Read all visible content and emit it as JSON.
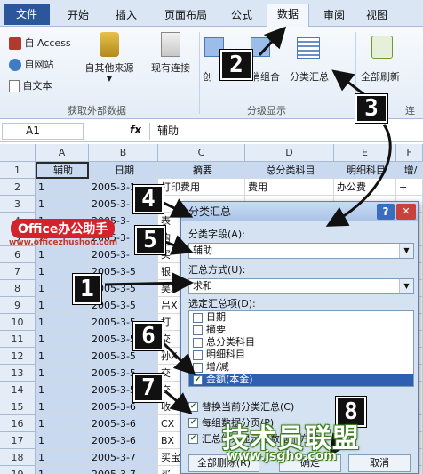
{
  "ribbon": {
    "tabs": [
      "文件",
      "开始",
      "插入",
      "页面布局",
      "公式",
      "数据",
      "审阅",
      "视图"
    ],
    "active_tab": "数据",
    "buttons": {
      "access": "自 Access",
      "web": "自网站",
      "text": "自文本",
      "other_sources": "自其他来源",
      "existing": "现有连接",
      "create_group": "创",
      "ungroup": "消组合",
      "subtotal": "分类汇总",
      "refresh_all": "全部刷新"
    },
    "group_labels": {
      "external": "获取外部数据",
      "outline": "分级显示",
      "connections": "连"
    }
  },
  "formula_bar": {
    "cell_ref": "A1",
    "fx": "fx",
    "value": "辅助"
  },
  "sheet": {
    "columns": [
      "A",
      "B",
      "C",
      "D",
      "E",
      "F"
    ],
    "header_row": [
      "辅助",
      "日期",
      "摘要",
      "总分类科目",
      "明细科目",
      "增/"
    ],
    "rows": [
      {
        "n": "1"
      },
      {
        "n": "2",
        "a": "1",
        "b": "2005-3-1",
        "c": "打印费用",
        "d": "费用",
        "e": "办公费",
        "f": "+"
      },
      {
        "n": "3",
        "a": "1",
        "b": "2005-3-"
      },
      {
        "n": "4",
        "a": "1",
        "b": "2005-3-",
        "c": "表"
      },
      {
        "n": "5",
        "a": "1",
        "b": "2005-3-",
        "c": "购"
      },
      {
        "n": "6",
        "a": "1",
        "b": "2005-3-",
        "c": "买"
      },
      {
        "n": "7",
        "a": "1",
        "b": "2005-3-5",
        "c": "银"
      },
      {
        "n": "8",
        "a": "1",
        "b": "2005-3-5",
        "c": "吴X"
      },
      {
        "n": "9",
        "a": "1",
        "b": "2005-3-5",
        "c": "吕X"
      },
      {
        "n": "10",
        "a": "1",
        "b": "2005-3-5",
        "c": "打"
      },
      {
        "n": "11",
        "a": "1",
        "b": "2005-3-5",
        "c": "交"
      },
      {
        "n": "12",
        "a": "1",
        "b": "2005-3-5",
        "c": "孙X"
      },
      {
        "n": "13",
        "a": "1",
        "b": "2005-3-5",
        "c": "交"
      },
      {
        "n": "14",
        "a": "1",
        "b": "2005-3-5",
        "c": "交"
      },
      {
        "n": "15",
        "a": "1",
        "b": "2005-3-6",
        "c": "收"
      },
      {
        "n": "16",
        "a": "1",
        "b": "2005-3-6",
        "c": "CX"
      },
      {
        "n": "17",
        "a": "1",
        "b": "2005-3-6",
        "c": "BX"
      },
      {
        "n": "18",
        "a": "1",
        "b": "2005-3-7",
        "c": "买宝"
      },
      {
        "n": "19",
        "a": "1",
        "b": "2005-3-7",
        "c": "买"
      }
    ]
  },
  "dialog": {
    "title": "分类汇总",
    "help": "?",
    "close": "✕",
    "group_by_label": "分类字段(A):",
    "group_by_value": "辅助",
    "func_label": "汇总方式(U):",
    "func_value": "求和",
    "items_label": "选定汇总项(D):",
    "items": [
      {
        "label": "日期",
        "checked": false
      },
      {
        "label": "摘要",
        "checked": false
      },
      {
        "label": "总分类科目",
        "checked": false
      },
      {
        "label": "明细科目",
        "checked": false
      },
      {
        "label": "增/减",
        "checked": false
      },
      {
        "label": "金额(本金)",
        "checked": true
      }
    ],
    "replace_label": "替换当前分类汇总(C)",
    "pagebreak_label": "每组数据分页(P)",
    "summary_label": "汇总结果显示在数据下方(S)",
    "remove_all": "全部删除(R)",
    "ok": "确定",
    "cancel": "取消"
  },
  "step_markers": [
    "1",
    "2",
    "3",
    "4",
    "5",
    "6",
    "7",
    "8"
  ],
  "branding": {
    "badge": "Office办公助手",
    "site": "www.officezhushou.com",
    "watermark": "技术员联盟",
    "watermark_url": "www.jsgho.com"
  }
}
